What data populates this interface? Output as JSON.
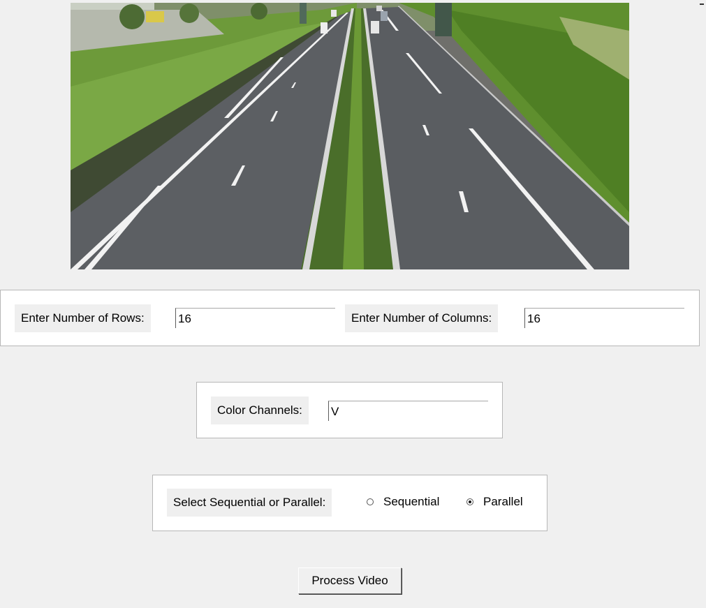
{
  "video": {
    "description_icon": "highway-video-frame"
  },
  "grid_panel": {
    "rows_label": "Enter Number of Rows:",
    "rows_value": "16",
    "cols_label": "Enter Number of Columns:",
    "cols_value": "16"
  },
  "channel_panel": {
    "label": "Color Channels:",
    "value": "V"
  },
  "mode_panel": {
    "label": "Select Sequential or Parallel:",
    "options": [
      {
        "label": "Sequential",
        "selected": false
      },
      {
        "label": "Parallel",
        "selected": true
      }
    ]
  },
  "actions": {
    "process_label": "Process Video"
  }
}
